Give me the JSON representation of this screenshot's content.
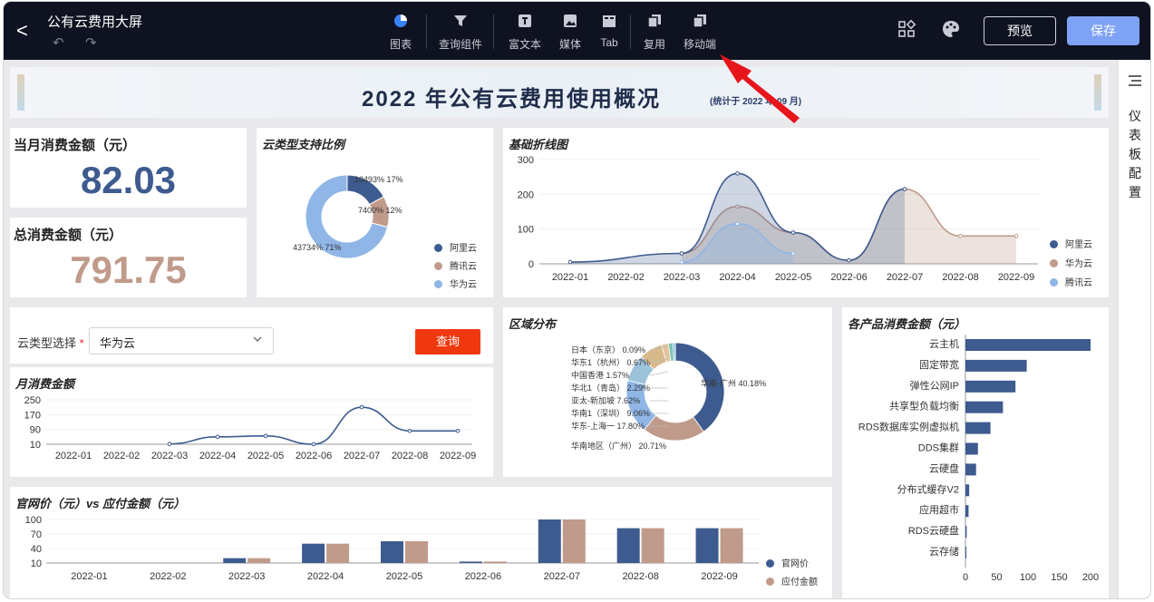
{
  "app": {
    "title": "公有云费用大屏",
    "back": "<",
    "undo": "↶",
    "redo": "↷"
  },
  "toolbar": {
    "tools": [
      {
        "label": "图表",
        "icon": "pie-chart-icon"
      },
      {
        "label": "查询组件",
        "icon": "filter-icon"
      },
      {
        "label": "富文本",
        "icon": "text-icon"
      },
      {
        "label": "媒体",
        "icon": "image-icon"
      },
      {
        "label": "Tab",
        "icon": "tab-icon"
      },
      {
        "label": "复用",
        "icon": "copy-icon"
      },
      {
        "label": "移动端",
        "icon": "mobile-icon"
      }
    ],
    "preview_label": "预览",
    "save_label": "保存"
  },
  "side_panel": {
    "label": "仪表板配置"
  },
  "banner": {
    "title": "2022 年公有云费用使用概况",
    "subtitle": "(统计于 2022 年 09 月)"
  },
  "kpi": {
    "monthly_label": "当月消费金额（元）",
    "monthly_value": "82.03",
    "monthly_color": "#3e5b8f",
    "total_label": "总消费金额（元）",
    "total_value": "791.75",
    "total_color": "#c09a8a"
  },
  "colors": {
    "aliyun": "#3e5b8f",
    "huawei": "#c09a8a",
    "tencent": "#8fb6e6",
    "accent": "#f0380f",
    "save": "#7ea2f5"
  },
  "cloud_type_card": {
    "title": "云类型支持比例",
    "legend": [
      "阿里云",
      "腾讯云",
      "华为云"
    ]
  },
  "line_card": {
    "title": "基础折线图",
    "legend": [
      "阿里云",
      "华为云",
      "腾讯云"
    ]
  },
  "filter": {
    "label": "云类型选择",
    "required": "*",
    "value": "华为云",
    "query_label": "查询"
  },
  "monthly_card": {
    "title": "月消费金额"
  },
  "region_card": {
    "title": "区域分布"
  },
  "product_card": {
    "title": "各产品消费金额（元）"
  },
  "compare_card": {
    "title": "官网价（元）vs 应付金额（元）",
    "legend": [
      "官网价",
      "应付金额"
    ]
  },
  "chart_data": [
    {
      "id": "cloud-type-donut",
      "type": "pie",
      "title": "云类型支持比例",
      "labels": [
        "阿里云",
        "腾讯云",
        "华为云"
      ],
      "values": [
        10493,
        7400,
        43734
      ],
      "data_labels": [
        "10493% 17%",
        "7400% 12%",
        "43734% 71%"
      ],
      "colors": [
        "#3e5b8f",
        "#c09a8a",
        "#8fb6e6"
      ],
      "legend_position": "right"
    },
    {
      "id": "basic-line",
      "type": "area",
      "title": "基础折线图",
      "categories": [
        "2022-01",
        "2022-02",
        "2022-03",
        "2022-04",
        "2022-05",
        "2022-06",
        "2022-07",
        "2022-08",
        "2022-09"
      ],
      "ylim": [
        0,
        300
      ],
      "yticks": [
        0,
        100,
        200,
        300
      ],
      "series": [
        {
          "name": "阿里云",
          "values": [
            5,
            null,
            30,
            260,
            90,
            10,
            215,
            null,
            null
          ]
        },
        {
          "name": "华为云",
          "values": [
            null,
            null,
            30,
            165,
            90,
            10,
            215,
            80,
            80
          ]
        },
        {
          "name": "腾讯云",
          "values": [
            null,
            null,
            5,
            115,
            30,
            null,
            null,
            null,
            null
          ]
        }
      ],
      "legend_position": "right"
    },
    {
      "id": "monthly-spend",
      "type": "line",
      "title": "月消费金额",
      "categories": [
        "2022-01",
        "2022-02",
        "2022-03",
        "2022-04",
        "2022-05",
        "2022-06",
        "2022-07",
        "2022-08",
        "2022-09"
      ],
      "ylim": [
        10,
        250
      ],
      "yticks": [
        10,
        90,
        170,
        250
      ],
      "values": [
        null,
        null,
        12,
        50,
        55,
        10,
        210,
        82,
        82
      ]
    },
    {
      "id": "region-donut",
      "type": "pie",
      "title": "区域分布",
      "labels": [
        "华南-广州",
        "华南地区（广州）",
        "华东-上海一",
        "华南1（深圳）",
        "亚太-新加坡",
        "华北1（青岛）",
        "中国香港",
        "华东1（杭州）",
        "日本（东京）"
      ],
      "values": [
        40.18,
        20.71,
        17.8,
        9.06,
        7.62,
        2.29,
        1.57,
        0.67,
        0.09
      ],
      "data_labels": [
        "华南-广州 40.18%",
        "华南地区（广州） 20.71%",
        "华东-上海一 17.80%",
        "华南1（深圳） 9.06%",
        "亚太-新加坡 7.62%",
        "华北1（青岛） 2.29%",
        "中国香港 1.57%",
        "华东1（杭州） 0.67%",
        "日本（东京） 0.09%"
      ],
      "colors": [
        "#3e5b8f",
        "#c09a8a",
        "#8fb6e6",
        "#9cc3da",
        "#d8b98c",
        "#e3c49a",
        "#7fc3b3",
        "#5aa8d6",
        "#f3d3a0"
      ]
    },
    {
      "id": "product-spend",
      "type": "bar",
      "orientation": "horizontal",
      "title": "各产品消费金额（元）",
      "categories": [
        "云主机",
        "固定带宽",
        "弹性公网IP",
        "共享型负载均衡",
        "RDS数据库实例虚拟机",
        "DDS集群",
        "云硬盘",
        "分布式缓存V2",
        "应用超市",
        "RDS云硬盘",
        "云存储"
      ],
      "values": [
        200,
        98,
        80,
        60,
        40,
        20,
        17,
        6,
        5,
        2,
        1
      ],
      "xlim": [
        0,
        200
      ],
      "xticks": [
        0,
        50,
        100,
        150,
        200
      ]
    },
    {
      "id": "price-compare",
      "type": "bar",
      "title": "官网价（元）vs 应付金额（元）",
      "categories": [
        "2022-01",
        "2022-02",
        "2022-03",
        "2022-04",
        "2022-05",
        "2022-06",
        "2022-07",
        "2022-08",
        "2022-09"
      ],
      "ylim": [
        10,
        100
      ],
      "yticks": [
        10,
        40,
        70,
        100
      ],
      "series": [
        {
          "name": "官网价",
          "values": [
            0,
            0,
            20,
            50,
            55,
            13,
            100,
            82,
            82
          ]
        },
        {
          "name": "应付金额",
          "values": [
            0,
            0,
            20,
            50,
            55,
            13,
            100,
            82,
            82
          ]
        }
      ],
      "legend_position": "right"
    }
  ]
}
